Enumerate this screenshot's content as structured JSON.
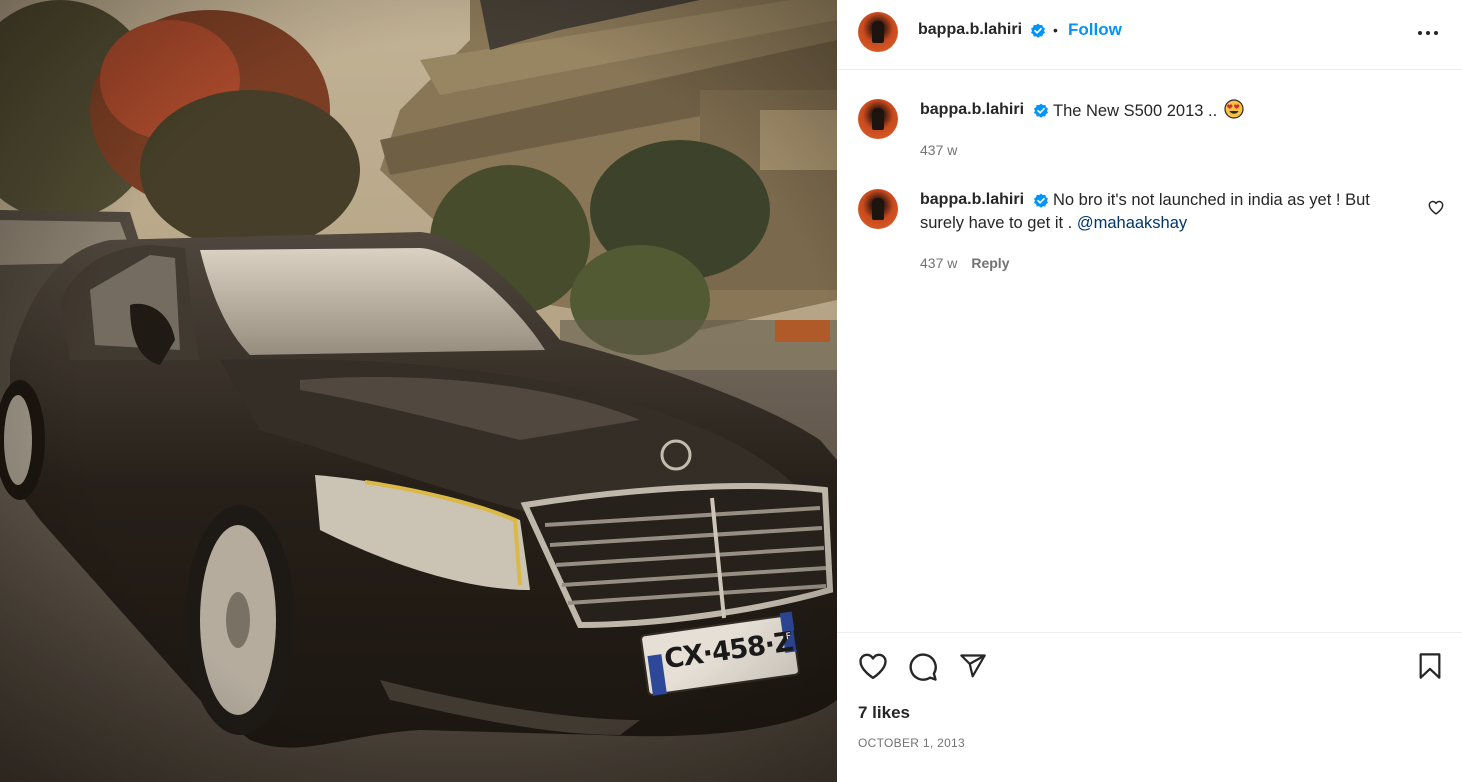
{
  "post": {
    "username": "bappa.b.lahiri",
    "verified": true,
    "follow_label": "Follow",
    "separator": "•",
    "more_icon": "more-options-icon",
    "photo": {
      "plate_text": "CX·458·ZF",
      "plate_region": "F"
    }
  },
  "caption": {
    "username": "bappa.b.lahiri",
    "text": "The New S500 2013 ..",
    "emoji": "heart-eyes-emoji",
    "age": "437 w"
  },
  "comments": [
    {
      "username": "bappa.b.lahiri",
      "text_line1": "No bro it's not launched in india as yet ! But",
      "text_line2": "surely have to get it .",
      "mention": "@mahaakshay",
      "age": "437 w",
      "reply_label": "Reply"
    }
  ],
  "footer": {
    "likes": "7 likes",
    "date": "OCTOBER 1, 2013"
  },
  "colors": {
    "accent": "#0095f6",
    "verified": "#0095f6",
    "mention": "#00376b",
    "muted": "#737373"
  }
}
